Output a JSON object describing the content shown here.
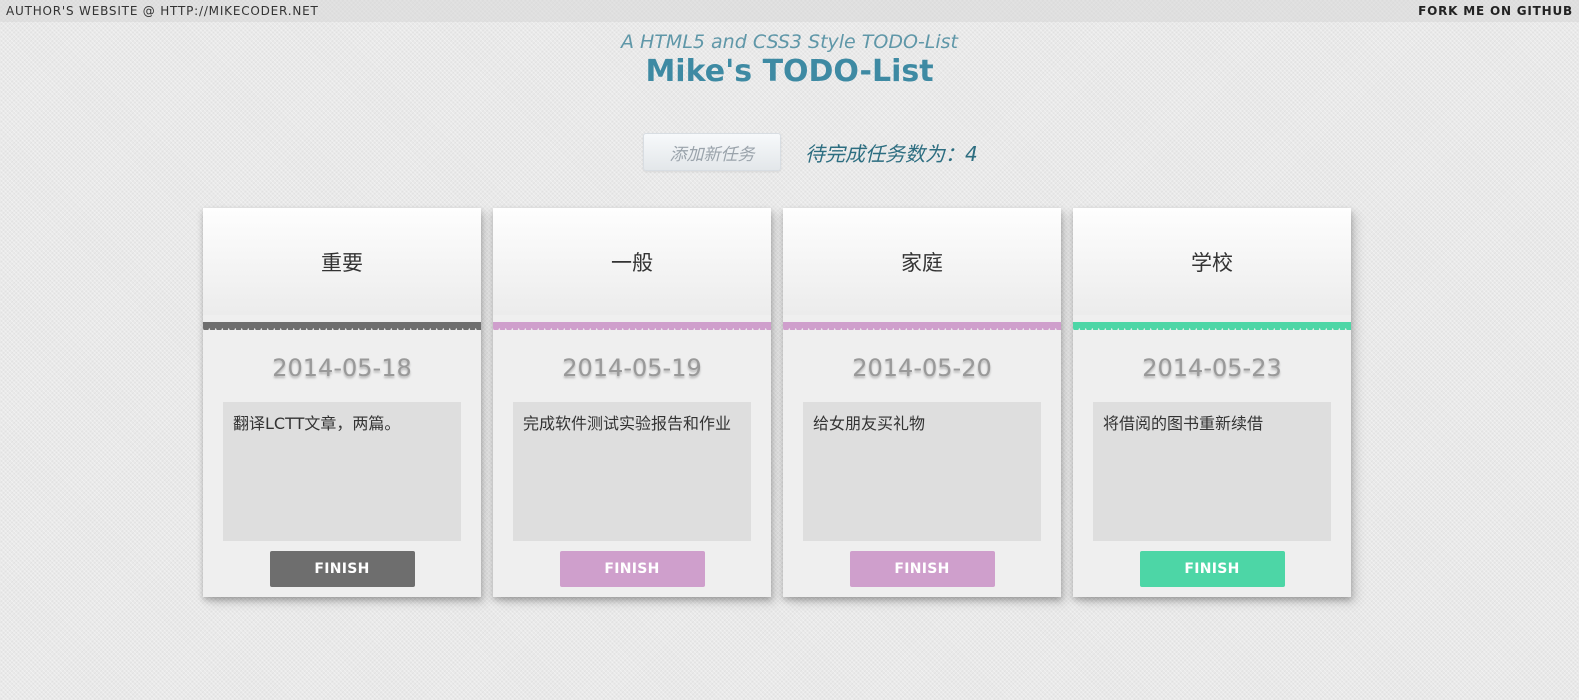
{
  "topbar": {
    "left_link": "AUTHOR'S WEBSITE @ HTTP://MIKECODER.NET",
    "right_link": "FORK ME ON GITHUB"
  },
  "header": {
    "subtitle": "A HTML5 and CSS3 Style TODO-List",
    "title": "Mike's TODO-List"
  },
  "controls": {
    "add_placeholder": "添加新任务",
    "pending_label": "待完成任务数为：",
    "pending_count": "4"
  },
  "cards": [
    {
      "category": "重要",
      "date": "2014-05-18",
      "text": "翻译LCTT文章，两篇。",
      "button": "FINISH",
      "color": "#6e6e6e"
    },
    {
      "category": "一般",
      "date": "2014-05-19",
      "text": "完成软件测试实验报告和作业",
      "button": "FINISH",
      "color": "#cf9fcc"
    },
    {
      "category": "家庭",
      "date": "2014-05-20",
      "text": "给女朋友买礼物",
      "button": "FINISH",
      "color": "#cf9fcc"
    },
    {
      "category": "学校",
      "date": "2014-05-23",
      "text": "将借阅的图书重新续借",
      "button": "FINISH",
      "color": "#4dd6a6"
    }
  ]
}
